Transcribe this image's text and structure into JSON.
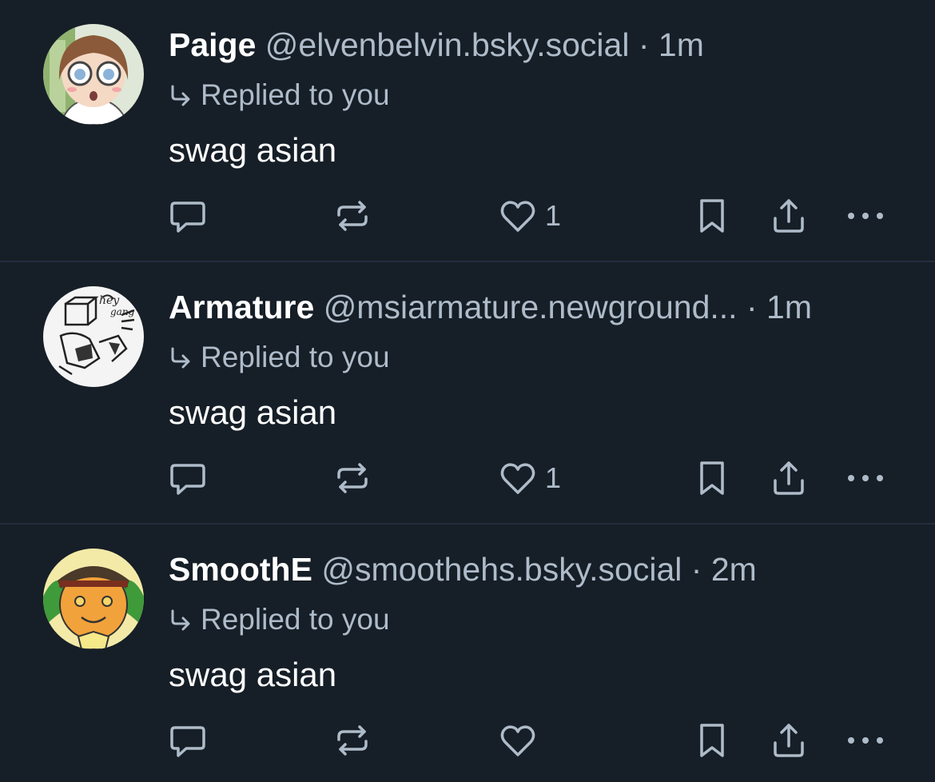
{
  "colors": {
    "background": "#161e27",
    "divider": "#232e3e",
    "muted": "#aebbc9",
    "text": "#ffffff"
  },
  "posts": [
    {
      "display_name": "Paige",
      "handle": "@elvenbelvin.bsky.social",
      "separator": "·",
      "time": "1m",
      "reply_text": "Replied to you",
      "body": "swag asian",
      "like_count": "1"
    },
    {
      "display_name": "Armature",
      "handle": "@msiarmature.newground...",
      "separator": "·",
      "time": "1m",
      "reply_text": "Replied to you",
      "body": "swag asian",
      "like_count": "1"
    },
    {
      "display_name": "SmoothE",
      "handle": "@smoothehs.bsky.social",
      "separator": "·",
      "time": "2m",
      "reply_text": "Replied to you",
      "body": "swag asian",
      "like_count": ""
    }
  ],
  "icons": {
    "reply": "speech-bubble-icon",
    "repost": "repost-arrows-icon",
    "like": "heart-icon",
    "bookmark": "bookmark-icon",
    "share": "share-upload-icon",
    "more": "more-dots-icon",
    "reply_indicator": "reply-arrow-icon"
  }
}
